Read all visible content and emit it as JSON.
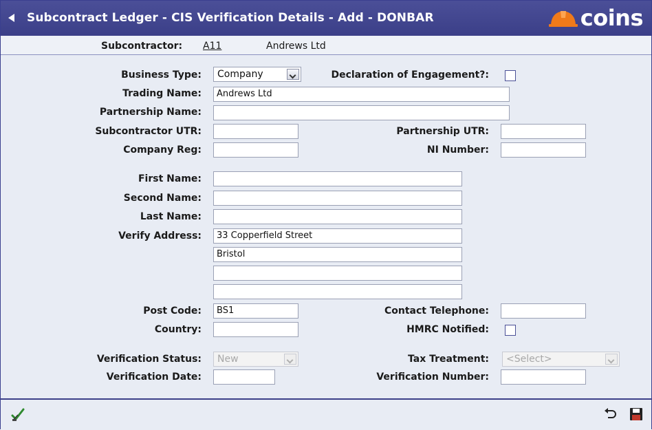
{
  "window": {
    "title": "Subcontract Ledger - CIS Verification Details - Add - DONBAR",
    "logo_text": "coins",
    "accent": "#3b3f88",
    "logo_color": "#f07a1a"
  },
  "subheader": {
    "label": "Subcontractor:",
    "code": "A11",
    "name": "Andrews Ltd"
  },
  "form": {
    "business_type": {
      "label": "Business Type:",
      "value": "Company"
    },
    "declaration": {
      "label": "Declaration of Engagement?:",
      "checked": false
    },
    "trading_name": {
      "label": "Trading Name:",
      "value": "Andrews Ltd"
    },
    "partnership_name": {
      "label": "Partnership Name:",
      "value": ""
    },
    "subcontractor_utr": {
      "label": "Subcontractor UTR:",
      "value": ""
    },
    "partnership_utr": {
      "label": "Partnership UTR:",
      "value": ""
    },
    "company_reg": {
      "label": "Company Reg:",
      "value": ""
    },
    "ni_number": {
      "label": "NI Number:",
      "value": ""
    },
    "first_name": {
      "label": "First Name:",
      "value": ""
    },
    "second_name": {
      "label": "Second Name:",
      "value": ""
    },
    "last_name": {
      "label": "Last Name:",
      "value": ""
    },
    "verify_address": {
      "label": "Verify Address:",
      "lines": [
        "33 Copperfield Street",
        "Bristol",
        "",
        ""
      ]
    },
    "post_code": {
      "label": "Post Code:",
      "value": "BS1"
    },
    "contact_telephone": {
      "label": "Contact Telephone:",
      "value": ""
    },
    "country": {
      "label": "Country:",
      "value": ""
    },
    "hmrc_notified": {
      "label": "HMRC Notified:",
      "checked": false
    },
    "verification_status": {
      "label": "Verification Status:",
      "value": "New"
    },
    "tax_treatment": {
      "label": "Tax Treatment:",
      "value": "<Select>"
    },
    "verification_date": {
      "label": "Verification Date:",
      "value": ""
    },
    "verification_number": {
      "label": "Verification Number:",
      "value": ""
    }
  },
  "footer": {
    "icons": [
      "approve-checkmark-icon",
      "undo-icon",
      "save-disk-icon"
    ]
  }
}
